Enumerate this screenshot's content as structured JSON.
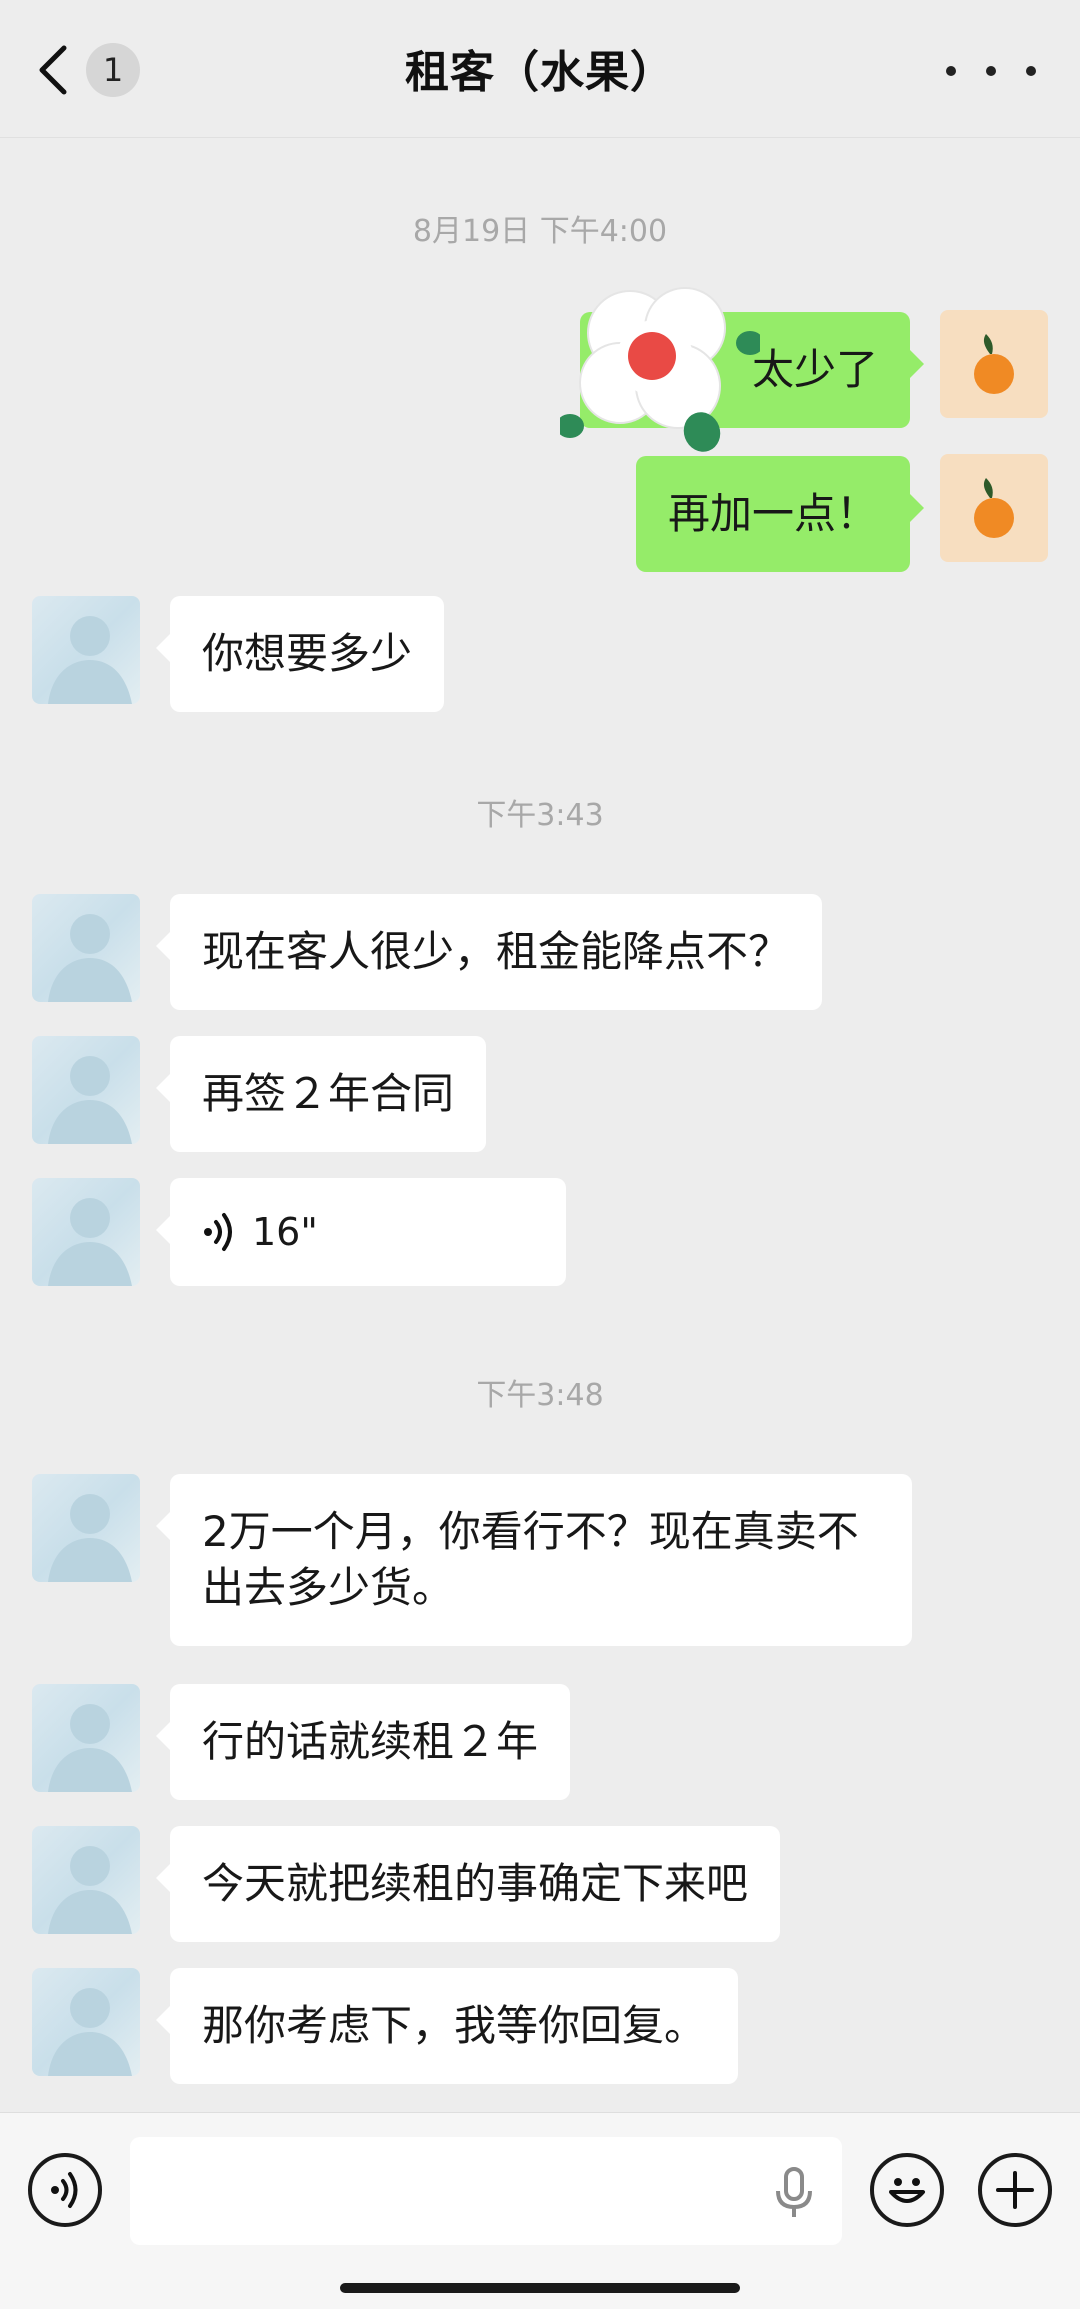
{
  "header": {
    "title": "租客（水果）",
    "unread_count": "1"
  },
  "timestamps": [
    "8月19日 下午4:00",
    "下午3:43",
    "下午3:48"
  ],
  "messages": [
    {
      "from": "self",
      "text": "太少了"
    },
    {
      "from": "self",
      "text": "再加一点！"
    },
    {
      "from": "contact",
      "text": "你想要多少"
    },
    {
      "from": "contact",
      "text": "现在客人很少，租金能降点不？"
    },
    {
      "from": "contact",
      "text": "再签２年合同"
    },
    {
      "from": "contact",
      "type": "voice",
      "text": "16\""
    },
    {
      "from": "contact",
      "text": "2万一个月，你看行不？现在真卖不出去多少货。"
    },
    {
      "from": "contact",
      "text": "行的话就续租２年"
    },
    {
      "from": "contact",
      "text": "今天就把续租的事确定下来吧"
    },
    {
      "from": "contact",
      "text": "那你考虑下，我等你回复。"
    }
  ],
  "colors": {
    "background": "#ededed",
    "outgoing_bubble": "#95ec69",
    "incoming_bubble": "#ffffff",
    "timestamp": "#a8a8a8"
  },
  "icons": {
    "back": "chevron-left-icon",
    "more": "ellipsis-icon",
    "voice_toggle": "voice-icon",
    "mic": "microphone-icon",
    "emoji": "smiley-icon",
    "plus": "plus-icon"
  }
}
